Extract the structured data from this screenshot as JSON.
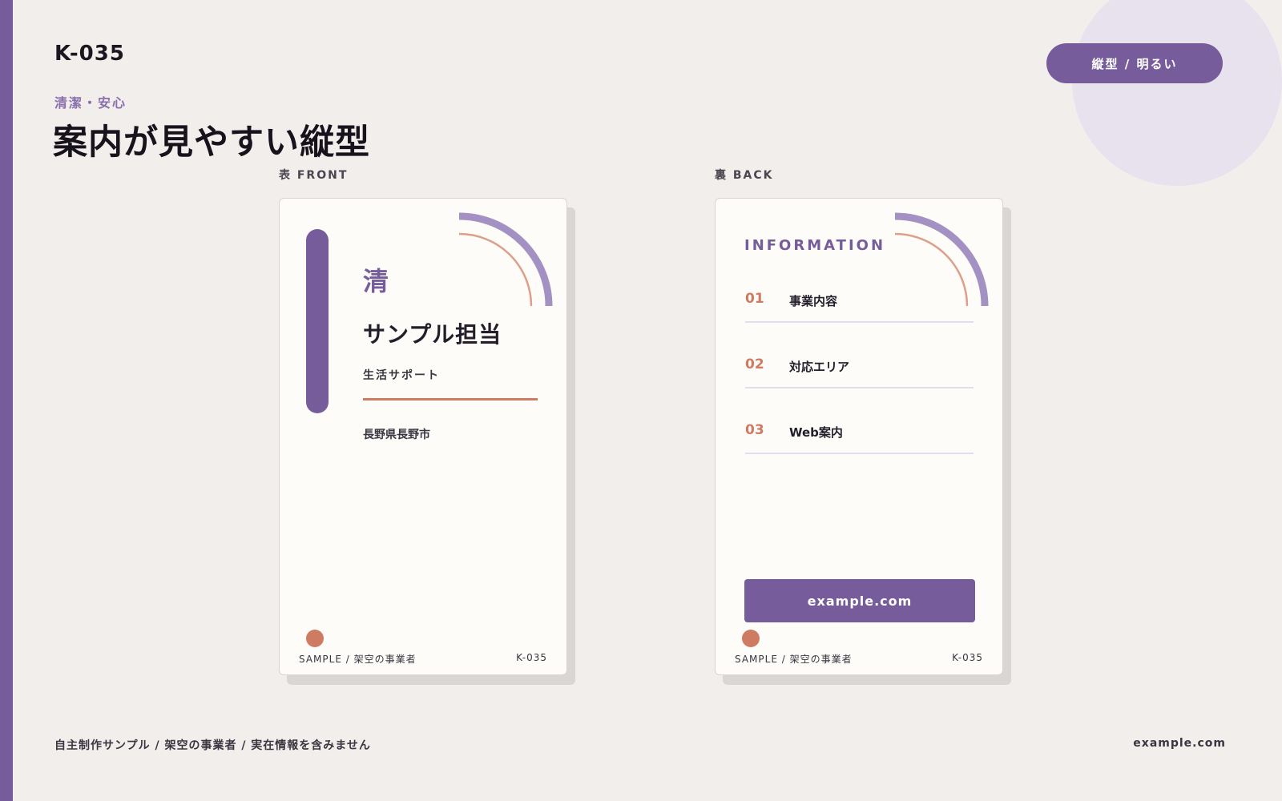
{
  "header": {
    "code": "K-035",
    "category": "清潔・安心",
    "title": "案内が見やすい縦型",
    "tag_button": "縦型 / 明るい"
  },
  "colors": {
    "accent": "#775c9c",
    "accent_light": "#a391c4",
    "coral": "#cf7b62",
    "background": "#f2eeeb",
    "card": "#fdfcf9"
  },
  "front": {
    "label": "表 FRONT",
    "kanji": "清",
    "name": "サンプル担当",
    "role": "生活サポート",
    "place": "長野県長野市",
    "footer_left": "SAMPLE / 架空の事業者",
    "footer_right": "K-035"
  },
  "back": {
    "label": "裏 BACK",
    "info_title": "INFORMATION",
    "items": [
      {
        "num": "01",
        "label": "事業内容"
      },
      {
        "num": "02",
        "label": "対応エリア"
      },
      {
        "num": "03",
        "label": "Web案内"
      }
    ],
    "web_button": "example.com",
    "footer_left": "SAMPLE / 架空の事業者",
    "footer_right": "K-035"
  },
  "footer": {
    "note": "自主制作サンプル / 架空の事業者 / 実在情報を含みません",
    "url": "example.com"
  }
}
